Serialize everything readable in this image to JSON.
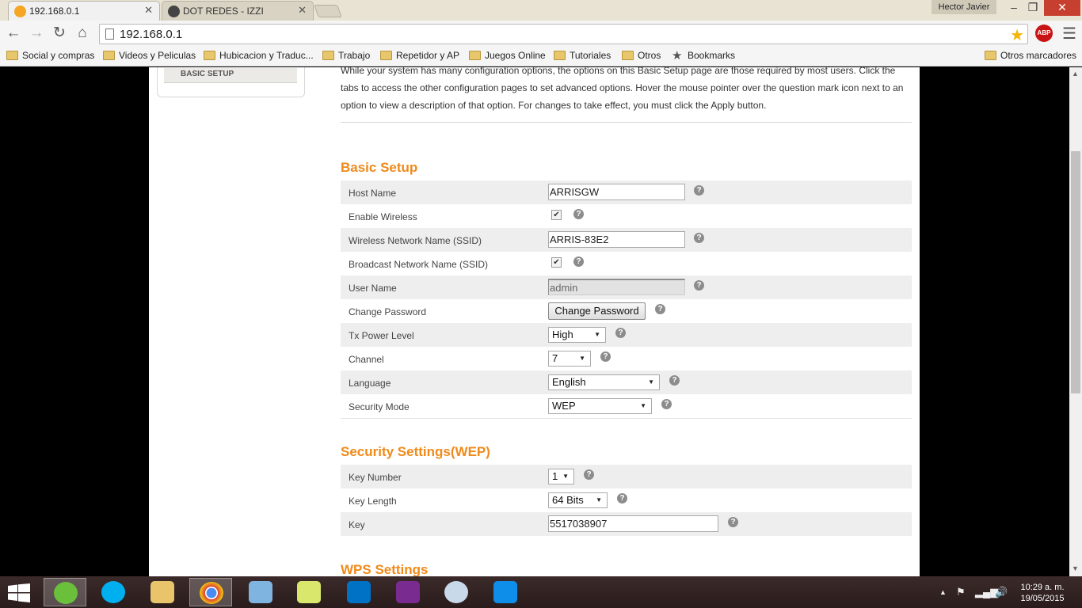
{
  "browser": {
    "tabs": [
      {
        "title": "192.168.0.1",
        "active": true
      },
      {
        "title": "DOT REDES - IZZI",
        "active": false
      }
    ],
    "profile_name": "Hector Javier",
    "url": "192.168.0.1",
    "abp_label": "ABP",
    "bookmarks": [
      "Social y compras",
      "Videos y Peliculas",
      "Hubicacion y Traduc...",
      "Trabajo",
      "Repetidor y AP",
      "Juegos Online",
      "Tutoriales",
      "Otros",
      "Bookmarks"
    ],
    "other_bookmarks": "Otros marcadores"
  },
  "page": {
    "nav_item": "BASIC SETUP",
    "intro": "While your system has many configuration options, the options on this Basic Setup page are those required by most users. Click the tabs to access the other configuration pages to set advanced options. Hover the mouse pointer over the question mark icon next to an option to view a description of that option. For changes to take effect, you must click the Apply button.",
    "basic_setup": {
      "title": "Basic Setup",
      "host_name": {
        "label": "Host Name",
        "value": "ARRISGW"
      },
      "enable_wireless": {
        "label": "Enable Wireless",
        "checked": true
      },
      "ssid": {
        "label": "Wireless Network Name (SSID)",
        "value": "ARRIS-83E2"
      },
      "broadcast_ssid": {
        "label": "Broadcast Network Name (SSID)",
        "checked": true
      },
      "user_name": {
        "label": "User Name",
        "value": "admin"
      },
      "change_password": {
        "label": "Change Password",
        "button": "Change Password"
      },
      "tx_power": {
        "label": "Tx Power Level",
        "value": "High"
      },
      "channel": {
        "label": "Channel",
        "value": "7"
      },
      "language": {
        "label": "Language",
        "value": "English"
      },
      "security_mode": {
        "label": "Security Mode",
        "value": "WEP"
      }
    },
    "security_settings": {
      "title": "Security Settings(WEP)",
      "key_number": {
        "label": "Key Number",
        "value": "1"
      },
      "key_length": {
        "label": "Key Length",
        "value": "64 Bits"
      },
      "key": {
        "label": "Key",
        "value": "5517038907"
      }
    },
    "wps_title": "WPS Settings",
    "help_glyph": "?",
    "check_glyph": "✔"
  },
  "taskbar": {
    "apps": [
      "utorrent-icon",
      "skype-icon",
      "file-explorer-icon",
      "chrome-icon",
      "network-monitor-icon",
      "sticky-notes-icon",
      "outlook-icon",
      "onenote-icon",
      "paint-icon",
      "teamviewer-icon"
    ],
    "time": "10:29 a. m.",
    "date": "19/05/2015"
  },
  "colors": {
    "section_title": "#f08a1a",
    "row_alt": "#eeeeee"
  }
}
